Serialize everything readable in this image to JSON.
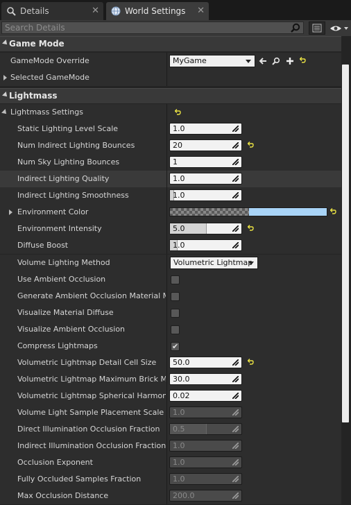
{
  "tabs": [
    {
      "label": "Details",
      "icon": "details-search-icon",
      "active": false
    },
    {
      "label": "World Settings",
      "icon": "globe-icon",
      "active": true
    }
  ],
  "search": {
    "placeholder": "Search Details"
  },
  "categories": {
    "game_mode": {
      "label": "Game Mode",
      "gamemode_override": {
        "label": "GameMode Override",
        "value": "MyGame"
      },
      "selected_gamemode": {
        "label": "Selected GameMode"
      }
    },
    "lightmass": {
      "label": "Lightmass",
      "settings_label": "Lightmass Settings",
      "properties": [
        {
          "label": "Static Lighting Level Scale",
          "type": "number",
          "value": "1.0"
        },
        {
          "label": "Num Indirect Lighting Bounces",
          "type": "number",
          "value": "20",
          "reset": true
        },
        {
          "label": "Num Sky Lighting Bounces",
          "type": "number",
          "value": "1"
        },
        {
          "label": "Indirect Lighting Quality",
          "type": "number",
          "value": "1.0"
        },
        {
          "label": "Indirect Lighting Smoothness",
          "type": "number",
          "value": "1.0",
          "slider": 0.05
        },
        {
          "label": "Environment Color",
          "type": "color",
          "color": "#a9d4f7",
          "reset": true
        },
        {
          "label": "Environment Intensity",
          "type": "number",
          "value": "5.0",
          "slider": 0.5,
          "reset": true
        },
        {
          "label": "Diffuse Boost",
          "type": "number",
          "value": "1.0",
          "slider": 0.1
        },
        {
          "label": "Volume Lighting Method",
          "type": "combo",
          "value": "Volumetric Lightmap"
        },
        {
          "label": "Use Ambient Occlusion",
          "type": "check",
          "checked": false
        },
        {
          "label": "Generate Ambient Occlusion Material Mask",
          "type": "check",
          "checked": false
        },
        {
          "label": "Visualize Material Diffuse",
          "type": "check",
          "checked": false
        },
        {
          "label": "Visualize Ambient Occlusion",
          "type": "check",
          "checked": false
        },
        {
          "label": "Compress Lightmaps",
          "type": "check",
          "checked": true
        },
        {
          "label": "Volumetric Lightmap Detail Cell Size",
          "type": "number",
          "value": "50.0",
          "reset": true
        },
        {
          "label": "Volumetric Lightmap Maximum Brick Memory",
          "type": "number",
          "value": "30.0"
        },
        {
          "label": "Volumetric Lightmap Spherical Harmonic Smoothing",
          "type": "number",
          "value": "0.02"
        },
        {
          "label": "Volume Light Sample Placement Scale",
          "type": "number",
          "value": "1.0",
          "disabled": true
        },
        {
          "label": "Direct Illumination Occlusion Fraction",
          "type": "number",
          "value": "0.5",
          "slider": 0.5,
          "disabled": true
        },
        {
          "label": "Indirect Illumination Occlusion Fraction",
          "type": "number",
          "value": "1.0",
          "disabled": true
        },
        {
          "label": "Occlusion Exponent",
          "type": "number",
          "value": "1.0",
          "disabled": true
        },
        {
          "label": "Fully Occluded Samples Fraction",
          "type": "number",
          "value": "1.0",
          "disabled": true
        },
        {
          "label": "Max Occlusion Distance",
          "type": "number",
          "value": "200.0",
          "disabled": true
        }
      ]
    }
  }
}
